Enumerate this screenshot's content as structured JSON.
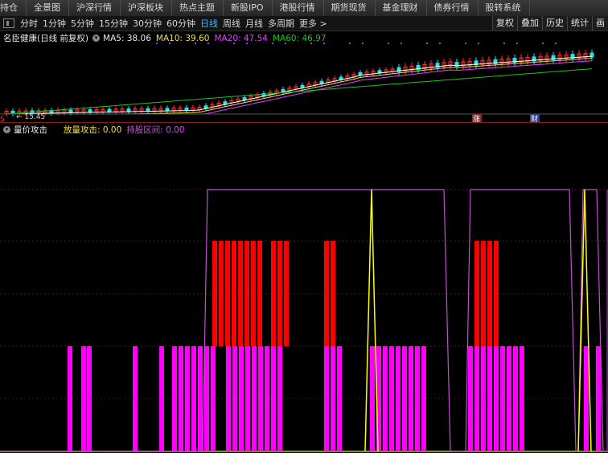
{
  "nav": {
    "items": [
      "持仓",
      "全景图",
      "沪深行情",
      "沪深板块",
      "热点主题",
      "新股IPO",
      "港股行情",
      "期货现货",
      "基金理财",
      "债券行情",
      "股转系统"
    ]
  },
  "periods": [
    "分时",
    "1分钟",
    "5分钟",
    "15分钟",
    "30分钟",
    "60分钟",
    "日线",
    "周线",
    "月线",
    "多周期",
    "更多 >"
  ],
  "active_period": "日线",
  "right_buttons": [
    "复权",
    "叠加",
    "历史",
    "统计",
    "画"
  ],
  "stock": {
    "name": "名臣健康(日线 前复权)",
    "ma5": "MA5: 38.06",
    "ma10": "MA10: 39.60",
    "ma20": "MA20: 47.54",
    "ma60": "MA60: 46.97",
    "low_label": "← 15.45",
    "s_marker": "S",
    "zhang_marker": "涨",
    "cai_marker": "财"
  },
  "indicator": {
    "name": "量价攻击",
    "attack": "放量攻击: 0.00",
    "hold": "持股区间: 0.00"
  },
  "colors": {
    "ma5": "#ffffff",
    "ma10": "#f0e040",
    "ma20": "#e040ff",
    "ma60": "#20c020",
    "attack_bar": "#ff0000",
    "volume_bar": "#ff00ff",
    "yellow_line": "#ffff00",
    "hold_line": "#c050d0"
  },
  "chart_data": {
    "type": "bar",
    "series": [
      {
        "name": "放量攻击",
        "bars": [
          {
            "x": 264,
            "level": 2
          },
          {
            "x": 272,
            "level": 2
          },
          {
            "x": 280,
            "level": 2
          },
          {
            "x": 288,
            "level": 2
          },
          {
            "x": 296,
            "level": 2
          },
          {
            "x": 304,
            "level": 2
          },
          {
            "x": 312,
            "level": 2
          },
          {
            "x": 320,
            "level": 2
          },
          {
            "x": 337,
            "level": 2
          },
          {
            "x": 345,
            "level": 2
          },
          {
            "x": 353,
            "level": 2
          },
          {
            "x": 403,
            "level": 2
          },
          {
            "x": 411,
            "level": 2
          },
          {
            "x": 590,
            "level": 2
          },
          {
            "x": 598,
            "level": 2
          },
          {
            "x": 606,
            "level": 2
          },
          {
            "x": 614,
            "level": 2
          }
        ]
      },
      {
        "name": "量价",
        "bars": [
          {
            "x": 84,
            "level": 1
          },
          {
            "x": 101,
            "level": 1
          },
          {
            "x": 108,
            "level": 1
          },
          {
            "x": 165,
            "level": 1
          },
          {
            "x": 198,
            "level": 1
          },
          {
            "x": 214,
            "level": 1
          },
          {
            "x": 222,
            "level": 1
          },
          {
            "x": 230,
            "level": 1
          },
          {
            "x": 238,
            "level": 1
          },
          {
            "x": 246,
            "level": 1
          },
          {
            "x": 254,
            "level": 1
          },
          {
            "x": 262,
            "level": 1
          },
          {
            "x": 281,
            "level": 1
          },
          {
            "x": 289,
            "level": 1
          },
          {
            "x": 297,
            "level": 1
          },
          {
            "x": 305,
            "level": 1
          },
          {
            "x": 313,
            "level": 1
          },
          {
            "x": 321,
            "level": 1
          },
          {
            "x": 329,
            "level": 1
          },
          {
            "x": 337,
            "level": 1
          },
          {
            "x": 345,
            "level": 1
          },
          {
            "x": 403,
            "level": 1
          },
          {
            "x": 411,
            "level": 1
          },
          {
            "x": 419,
            "level": 1
          },
          {
            "x": 460,
            "level": 1
          },
          {
            "x": 468,
            "level": 1
          },
          {
            "x": 476,
            "level": 1
          },
          {
            "x": 484,
            "level": 1
          },
          {
            "x": 492,
            "level": 1
          },
          {
            "x": 500,
            "level": 1
          },
          {
            "x": 508,
            "level": 1
          },
          {
            "x": 516,
            "level": 1
          },
          {
            "x": 524,
            "level": 1
          },
          {
            "x": 582,
            "level": 1
          },
          {
            "x": 590,
            "level": 1
          },
          {
            "x": 598,
            "level": 1
          },
          {
            "x": 606,
            "level": 1
          },
          {
            "x": 614,
            "level": 1
          },
          {
            "x": 622,
            "level": 1
          },
          {
            "x": 630,
            "level": 1
          },
          {
            "x": 638,
            "level": 1
          },
          {
            "x": 646,
            "level": 1
          },
          {
            "x": 726,
            "level": 1
          },
          {
            "x": 741,
            "level": 1
          }
        ]
      }
    ],
    "hold_intervals": [
      [
        258,
        552
      ],
      [
        585,
        708
      ],
      [
        725,
        742
      ]
    ],
    "yellow_spikes": [
      462,
      727
    ]
  }
}
